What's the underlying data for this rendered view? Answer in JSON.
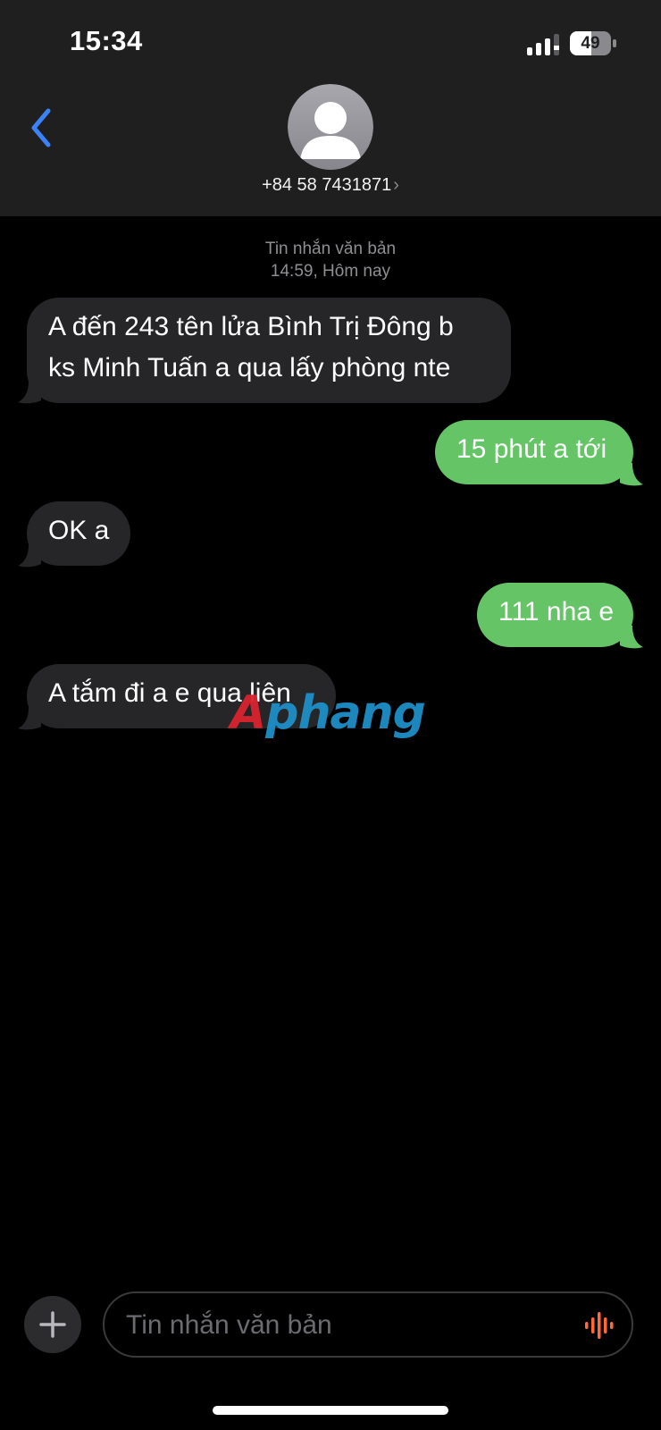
{
  "status_bar": {
    "time": "15:34",
    "battery": "49",
    "icons": [
      "signal-icon",
      "battery-icon"
    ]
  },
  "header": {
    "back_icon": "chevron-left-icon",
    "avatar_icon": "person-icon",
    "contact": "+84 58 7431871",
    "contact_chevron": "›"
  },
  "thread": {
    "meta_label": "Tin nhắn văn bản",
    "meta_time": "14:59,",
    "meta_day": "Hôm nay",
    "messages": [
      {
        "direction": "incoming",
        "lines": [
          "A đến 243 tên lửa Bình Trị Đông b",
          "ks Minh Tuấn a qua lấy phòng nte"
        ]
      },
      {
        "direction": "outgoing",
        "lines": [
          "15 phút a tới"
        ]
      },
      {
        "direction": "incoming",
        "lines": [
          "OK a"
        ]
      },
      {
        "direction": "outgoing",
        "lines": [
          "111 nha e"
        ]
      },
      {
        "direction": "incoming",
        "lines": [
          "A tắm đi a e qua liên"
        ]
      }
    ]
  },
  "watermark": {
    "text": "Aphang"
  },
  "composer": {
    "placeholder": "Tin nhắn văn bản",
    "value": "",
    "plus_icon": "plus-icon",
    "mic_icon": "waveform-icon"
  },
  "colors": {
    "header_bg": "#1f1f1f",
    "incoming_bubble": "#262628",
    "outgoing_bubble": "#65c466",
    "accent": "#3b82f6",
    "mic": "#ff6a3d"
  }
}
